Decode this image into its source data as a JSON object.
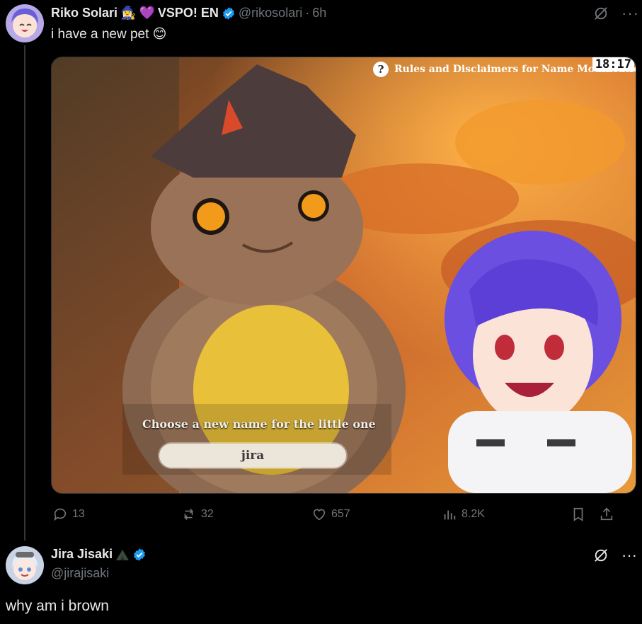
{
  "tweet": {
    "author_name": "Riko Solari",
    "author_suffix": "VSPO! EN",
    "handle": "@rikosolari",
    "dot": "·",
    "time": "6h",
    "text": "i have a new pet",
    "emoji_text": "😊",
    "media": {
      "game_hint": "Rules and Disclaimers for Name Modification",
      "clock": "18:17",
      "prompt": "Choose a new name for the little one",
      "input_value": "jira"
    },
    "stats": {
      "replies": "13",
      "reposts": "32",
      "likes": "657",
      "views": "8.2K"
    }
  },
  "reply": {
    "author_name": "Jira Jisaki",
    "handle": "@jirajisaki",
    "text": "why am i brown"
  },
  "colors": {
    "background": "#000000",
    "text": "#e7e9ea",
    "muted": "#71767b",
    "verified": "#1d9bf0"
  }
}
